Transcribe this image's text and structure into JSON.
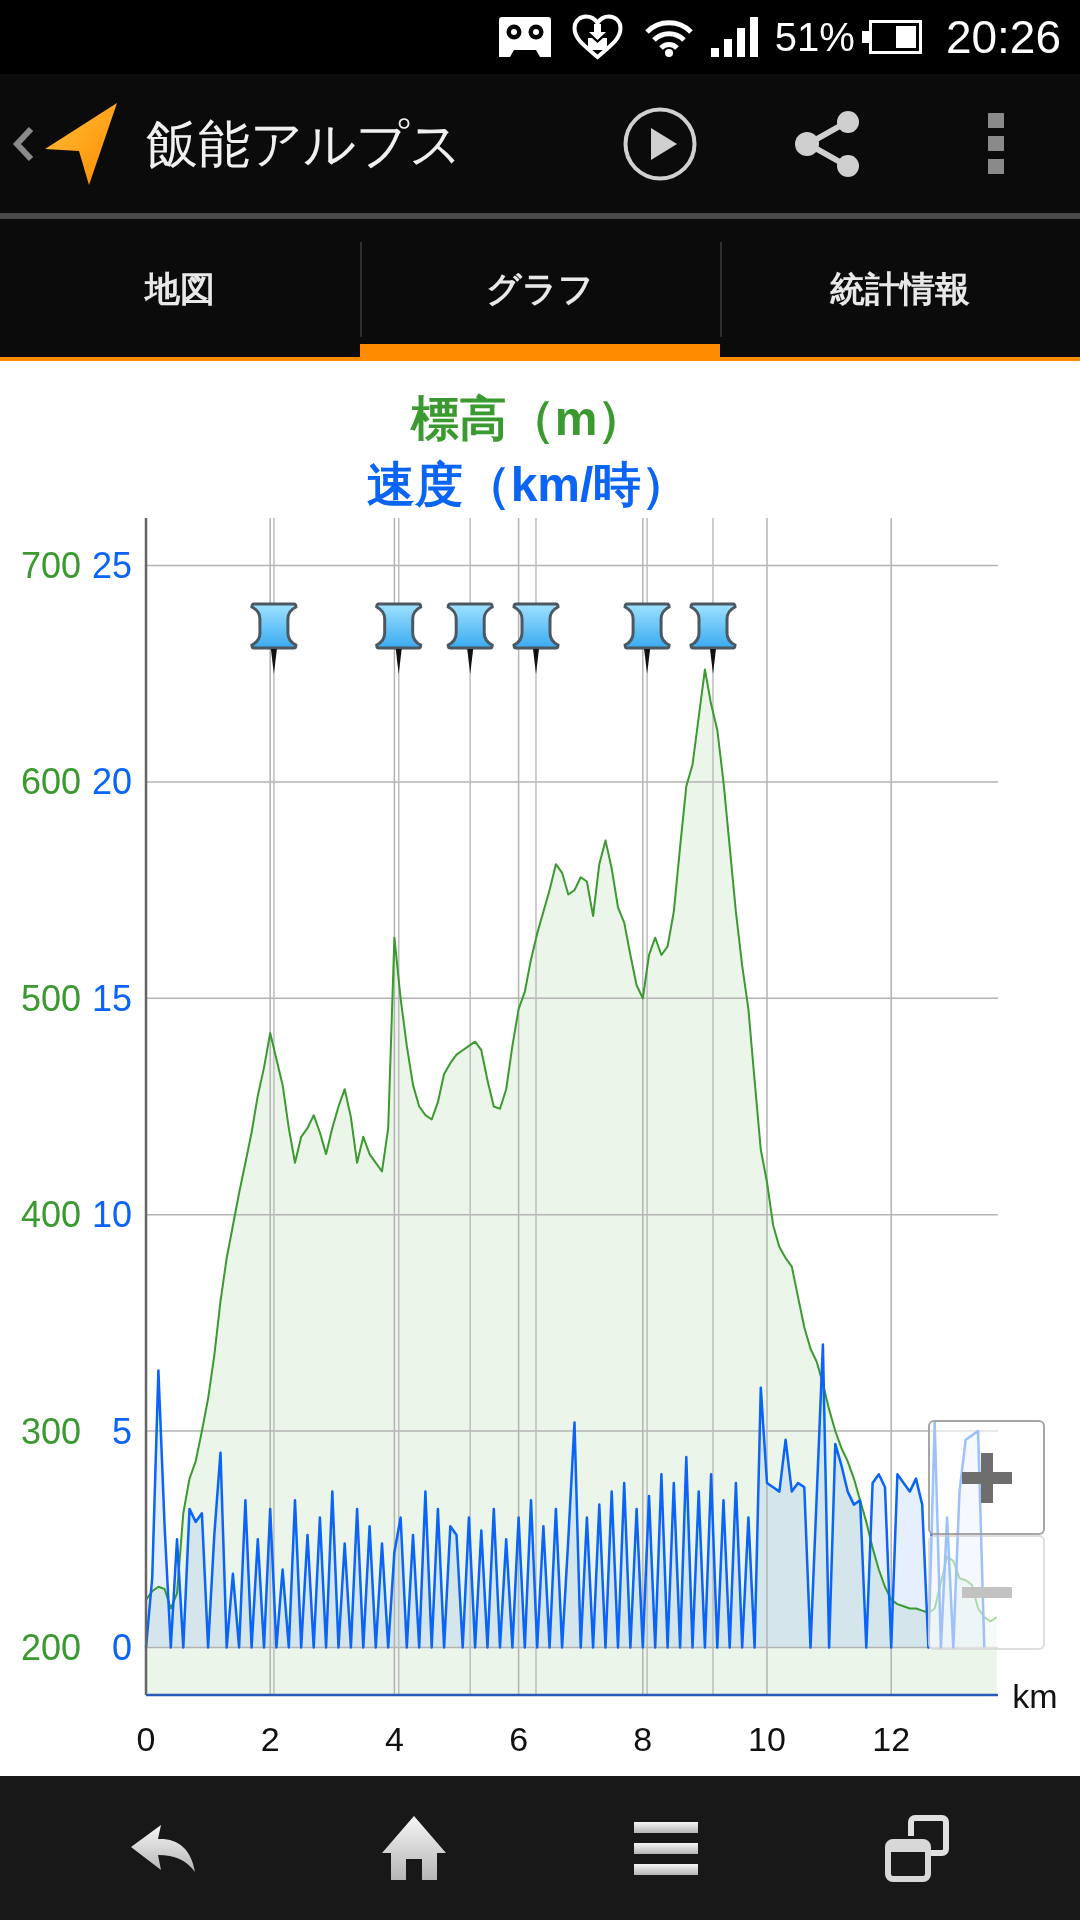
{
  "status_bar": {
    "battery": "51%",
    "time": "20:26"
  },
  "app_bar": {
    "title": "飯能アルプス"
  },
  "tabs": [
    {
      "label": "地図",
      "selected": false
    },
    {
      "label": "グラフ",
      "selected": true
    },
    {
      "label": "統計情報",
      "selected": false
    }
  ],
  "graph": {
    "chart_data": {
      "type": "area",
      "grid": true,
      "xlabel": "km",
      "xlim": [
        0,
        13.72
      ],
      "xticks": [
        0,
        2,
        4,
        6,
        8,
        10,
        12
      ],
      "ylim": [
        178,
        722
      ],
      "yticks": [
        200,
        300,
        400,
        500,
        600,
        700
      ],
      "y2lim": [
        -1.1,
        26.1
      ],
      "y2ticks": [
        0,
        5,
        10,
        15,
        20,
        25
      ],
      "x": [
        0,
        0.1,
        0.2,
        0.3,
        0.4,
        0.5,
        0.6,
        0.7,
        0.8,
        0.9,
        1,
        1.1,
        1.2,
        1.3,
        1.4,
        1.5,
        1.6,
        1.7,
        1.8,
        1.9,
        2,
        2.1,
        2.2,
        2.3,
        2.4,
        2.5,
        2.6,
        2.7,
        2.8,
        2.9,
        3,
        3.1,
        3.2,
        3.3,
        3.4,
        3.5,
        3.6,
        3.7,
        3.8,
        3.9,
        4,
        4.1,
        4.2,
        4.3,
        4.4,
        4.5,
        4.6,
        4.7,
        4.8,
        4.9,
        5,
        5.1,
        5.2,
        5.3,
        5.4,
        5.5,
        5.6,
        5.7,
        5.8,
        5.9,
        6,
        6.1,
        6.2,
        6.3,
        6.4,
        6.5,
        6.6,
        6.7,
        6.8,
        6.9,
        7,
        7.1,
        7.2,
        7.3,
        7.4,
        7.5,
        7.6,
        7.7,
        7.8,
        7.9,
        8,
        8.1,
        8.2,
        8.3,
        8.4,
        8.5,
        8.6,
        8.7,
        8.8,
        8.9,
        9,
        9.1,
        9.2,
        9.3,
        9.4,
        9.5,
        9.6,
        9.7,
        9.8,
        9.9,
        10,
        10.1,
        10.2,
        10.3,
        10.4,
        10.5,
        10.6,
        10.7,
        10.8,
        10.9,
        11,
        11.1,
        11.2,
        11.3,
        11.4,
        11.5,
        11.6,
        11.7,
        11.8,
        11.9,
        12,
        12.1,
        12.2,
        12.3,
        12.4,
        12.5,
        12.6,
        12.7,
        12.8,
        12.9,
        13,
        13.1,
        13.2,
        13.3,
        13.4,
        13.5,
        13.6,
        13.7
      ],
      "series": [
        {
          "name": "標高（m）",
          "color": "#3a9a2f",
          "axis": "y",
          "values": [
            222,
            226,
            228,
            227,
            218,
            225,
            262,
            278,
            286,
            300,
            315,
            335,
            360,
            380,
            395,
            410,
            424,
            438,
            455,
            468,
            484,
            472,
            460,
            440,
            424,
            436,
            440,
            446,
            438,
            428,
            440,
            450,
            458,
            445,
            424,
            436,
            428,
            424,
            420,
            440,
            528,
            500,
            478,
            460,
            450,
            446,
            444,
            452,
            465,
            470,
            474,
            476,
            478,
            480,
            476,
            462,
            450,
            449,
            458,
            478,
            495,
            503,
            518,
            530,
            540,
            550,
            562,
            558,
            548,
            550,
            556,
            554,
            538,
            562,
            573,
            560,
            542,
            535,
            520,
            506,
            500,
            520,
            528,
            520,
            524,
            540,
            570,
            598,
            608,
            630,
            652,
            636,
            624,
            600,
            570,
            540,
            515,
            495,
            462,
            430,
            415,
            395,
            385,
            380,
            376,
            362,
            348,
            338,
            332,
            322,
            310,
            300,
            292,
            286,
            278,
            268,
            258,
            246,
            236,
            228,
            222,
            220,
            219,
            218,
            218,
            217,
            216,
            218,
            230,
            242,
            240,
            232,
            231,
            229,
            218,
            214,
            212,
            214
          ]
        },
        {
          "name": "速度（km/時）",
          "color": "#0a64f5",
          "axis": "y2",
          "values": [
            0,
            1.6,
            6.4,
            2.8,
            0,
            2.5,
            0,
            3.2,
            2.9,
            3.1,
            0,
            2.6,
            4.5,
            0,
            1.7,
            0,
            3.4,
            0,
            2.5,
            0,
            3.2,
            0,
            1.8,
            0,
            3.4,
            0,
            2.6,
            0,
            3.0,
            0,
            3.6,
            0,
            2.4,
            0,
            3.2,
            0,
            2.8,
            0,
            2.4,
            0,
            2.2,
            3.0,
            0,
            2.6,
            0,
            3.6,
            0,
            3.2,
            0,
            2.8,
            2.6,
            0,
            3.0,
            0,
            2.7,
            0,
            3.2,
            0,
            2.5,
            0,
            3.0,
            0,
            3.4,
            0,
            2.8,
            0,
            3.2,
            0,
            2.5,
            5.2,
            0,
            3.0,
            0,
            3.3,
            0,
            3.6,
            0,
            3.8,
            0,
            3.2,
            0,
            3.5,
            0,
            4.0,
            0,
            3.8,
            0,
            4.4,
            0,
            3.6,
            0,
            4.0,
            0,
            3.4,
            0,
            3.8,
            0,
            3.0,
            0,
            6.0,
            3.8,
            3.7,
            3.6,
            4.8,
            3.6,
            3.8,
            3.7,
            0,
            3.5,
            7.0,
            0,
            4.7,
            4.2,
            3.6,
            3.3,
            3.4,
            0,
            3.8,
            4.0,
            3.7,
            0,
            4.0,
            3.8,
            3.6,
            3.9,
            3.3,
            0,
            5.2,
            0,
            3.0,
            0,
            3.6,
            4.8,
            4.9,
            5.0,
            0,
            null,
            null
          ]
        }
      ],
      "ref_lines": [
        {
          "axis": "x",
          "value": 2.06
        },
        {
          "axis": "x",
          "value": 4.07
        },
        {
          "axis": "x",
          "value": 5.22
        },
        {
          "axis": "x",
          "value": 6.28
        },
        {
          "axis": "x",
          "value": 8.07
        },
        {
          "axis": "x",
          "value": 9.13
        }
      ]
    },
    "zoom_controls": [
      {
        "kind": "zoom_in",
        "disabled": false
      },
      {
        "kind": "zoom_out",
        "disabled": true
      }
    ]
  }
}
